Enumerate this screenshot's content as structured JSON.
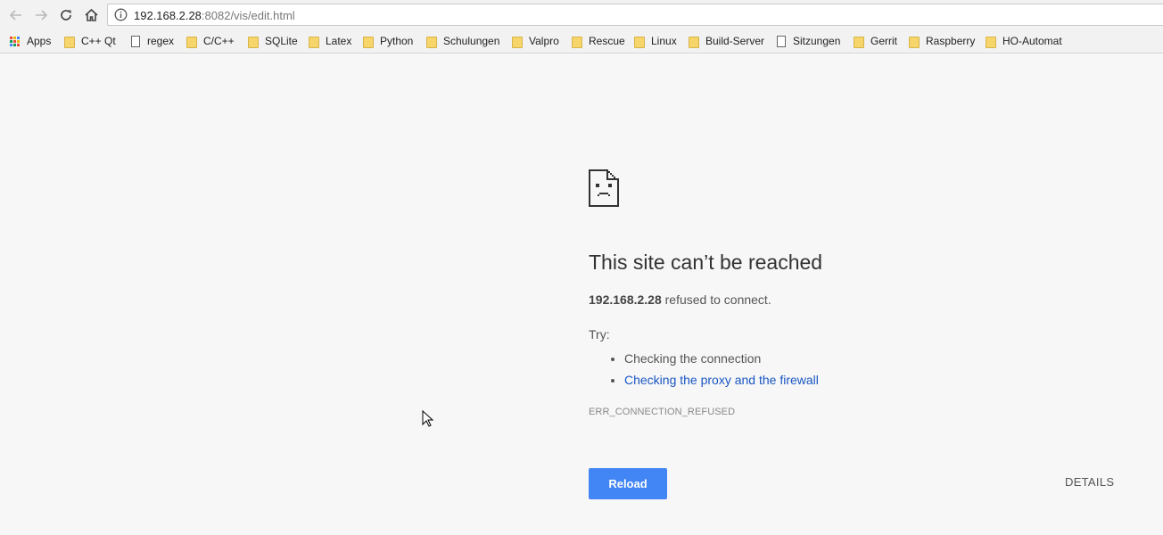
{
  "browser": {
    "url_host": "192.168.2.28",
    "url_rest": ":8082/vis/edit.html"
  },
  "bookmarks": [
    {
      "label": "Apps",
      "icon": "apps-grid-icon"
    },
    {
      "label": "C++ Qt",
      "icon": "folder-icon"
    },
    {
      "label": "regex",
      "icon": "page-icon"
    },
    {
      "label": "C/C++",
      "icon": "folder-icon"
    },
    {
      "label": "SQLite",
      "icon": "folder-icon"
    },
    {
      "label": "Latex",
      "icon": "folder-icon"
    },
    {
      "label": "Python",
      "icon": "folder-icon"
    },
    {
      "label": "Schulungen",
      "icon": "folder-icon"
    },
    {
      "label": "Valpro",
      "icon": "folder-icon"
    },
    {
      "label": "Rescue",
      "icon": "folder-icon"
    },
    {
      "label": "Linux",
      "icon": "folder-icon"
    },
    {
      "label": "Build-Server",
      "icon": "folder-icon"
    },
    {
      "label": "Sitzungen",
      "icon": "page-icon"
    },
    {
      "label": "Gerrit",
      "icon": "folder-icon"
    },
    {
      "label": "Raspberry",
      "icon": "folder-icon"
    },
    {
      "label": "HO-Automat",
      "icon": "folder-icon"
    }
  ],
  "error": {
    "title": "This site can’t be reached",
    "host": "192.168.2.28",
    "message_suffix": " refused to connect.",
    "try_label": "Try:",
    "suggestions": [
      "Checking the connection",
      "Checking the proxy and the firewall"
    ],
    "code": "ERR_CONNECTION_REFUSED",
    "reload_label": "Reload",
    "details_label": "DETAILS"
  },
  "colors": {
    "accent": "#4285f4",
    "link": "#1a56c4",
    "background": "#f7f7f7"
  }
}
